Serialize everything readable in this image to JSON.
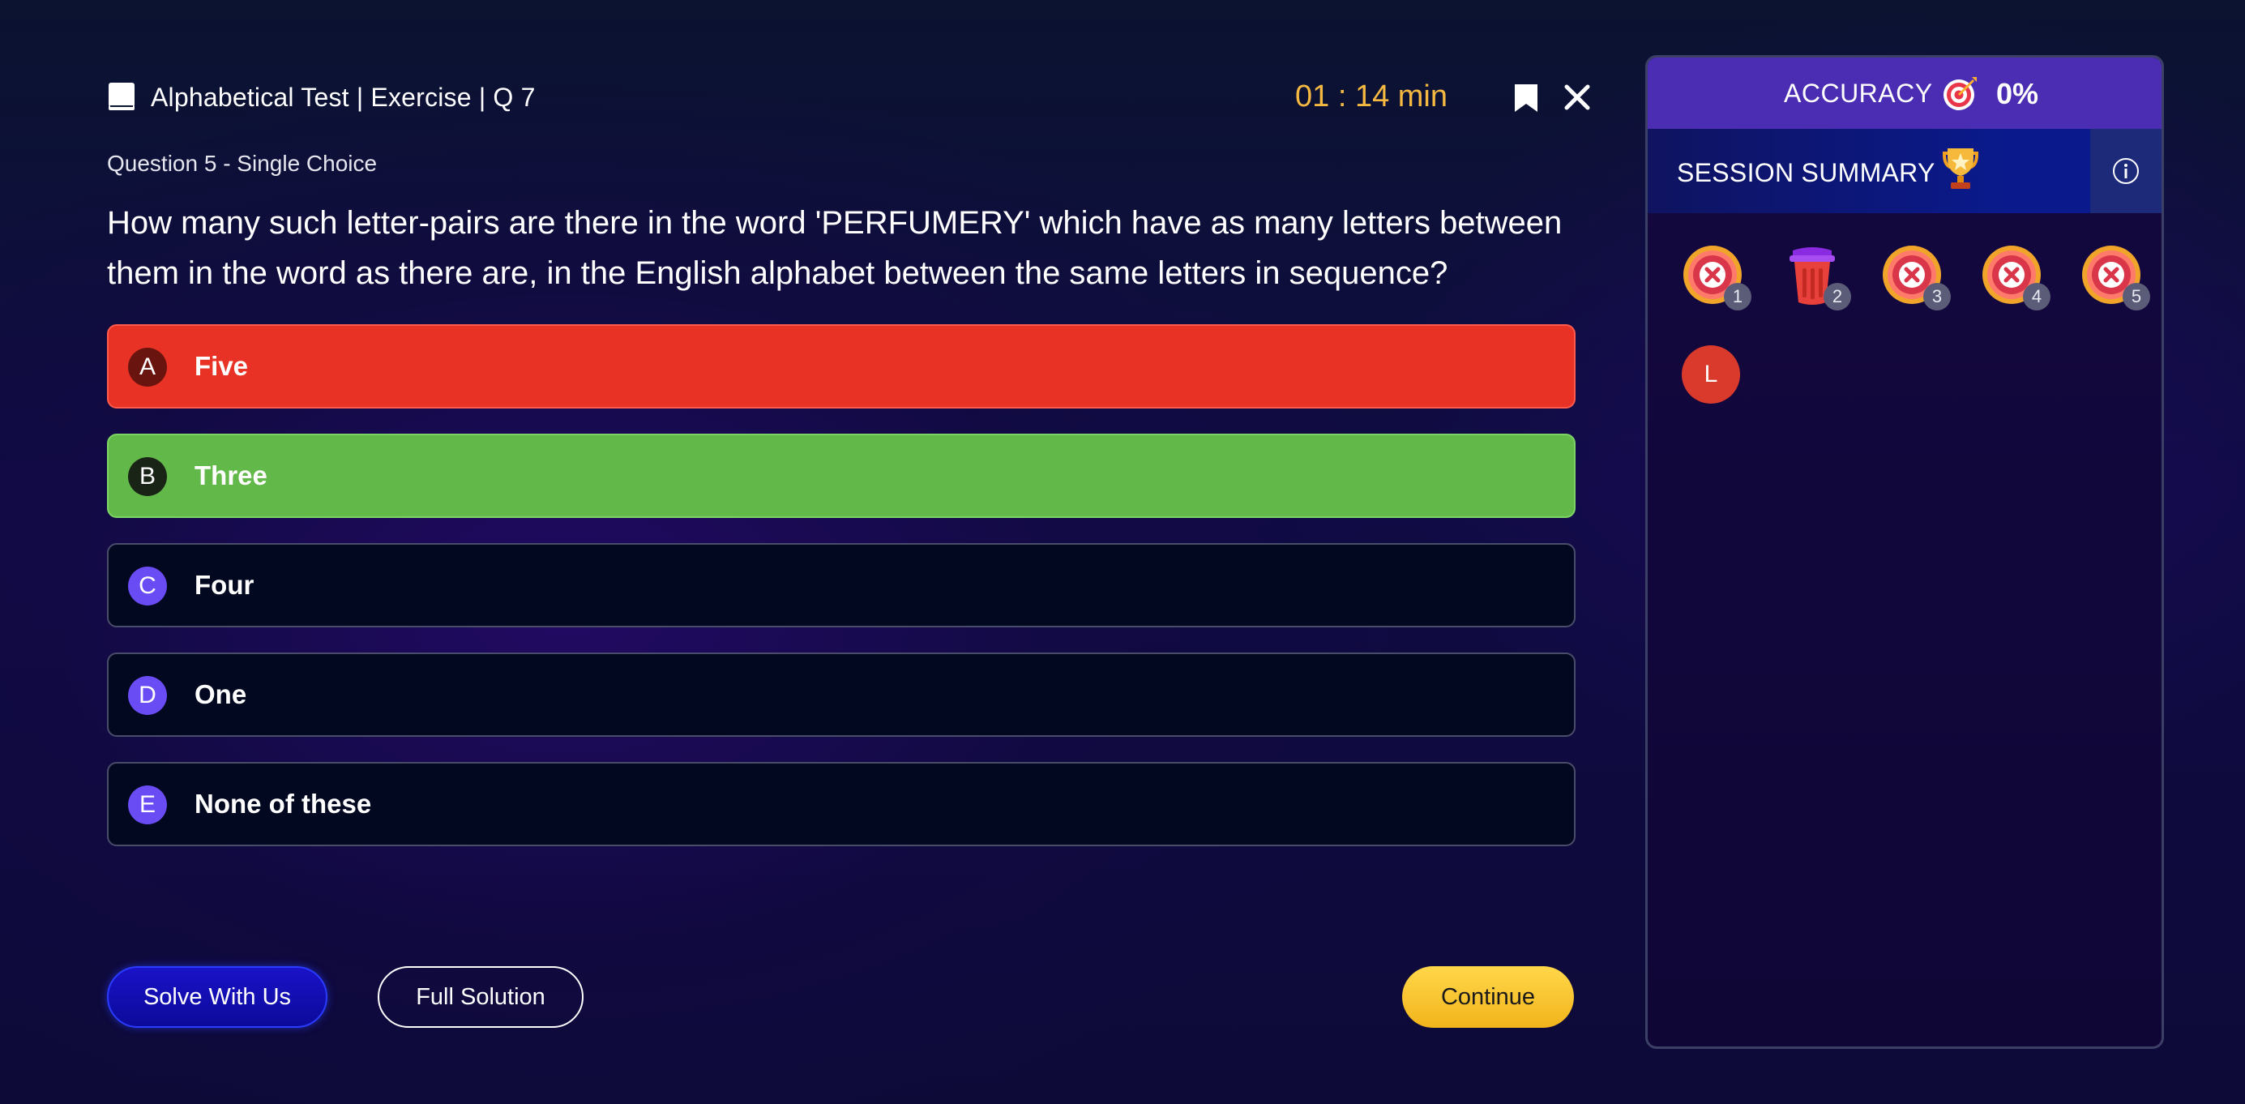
{
  "header": {
    "title": "Alphabetical Test | Exercise | Q 7",
    "timer": "01 : 14 min"
  },
  "question": {
    "type_label": "Question 5 - Single Choice",
    "text": "How many such letter-pairs are there in the word 'PERFUMERY' which have as many letters between them in the word as there are, in the English alphabet between the same letters in sequence?"
  },
  "options": [
    {
      "letter": "A",
      "text": "Five",
      "state": "wrong"
    },
    {
      "letter": "B",
      "text": "Three",
      "state": "correct"
    },
    {
      "letter": "C",
      "text": "Four",
      "state": "default"
    },
    {
      "letter": "D",
      "text": "One",
      "state": "default"
    },
    {
      "letter": "E",
      "text": "None of these",
      "state": "default"
    }
  ],
  "buttons": {
    "solve": "Solve With Us",
    "full_solution": "Full Solution",
    "continue": "Continue"
  },
  "panel": {
    "accuracy_label": "ACCURACY",
    "accuracy_value": "0%",
    "summary_label": "SESSION SUMMARY",
    "items": [
      {
        "number": "1",
        "icon": "wrong-answer-icon"
      },
      {
        "number": "2",
        "icon": "trash-icon"
      },
      {
        "number": "3",
        "icon": "wrong-answer-icon"
      },
      {
        "number": "4",
        "icon": "wrong-answer-icon"
      },
      {
        "number": "5",
        "icon": "wrong-answer-icon"
      }
    ],
    "avatar_letter": "L"
  },
  "colors": {
    "accent_yellow": "#f5b942",
    "wrong": "#e83225",
    "correct": "#62b94a",
    "option_letter": "#6a4cf5",
    "accuracy_bar": "#4a2db2"
  }
}
